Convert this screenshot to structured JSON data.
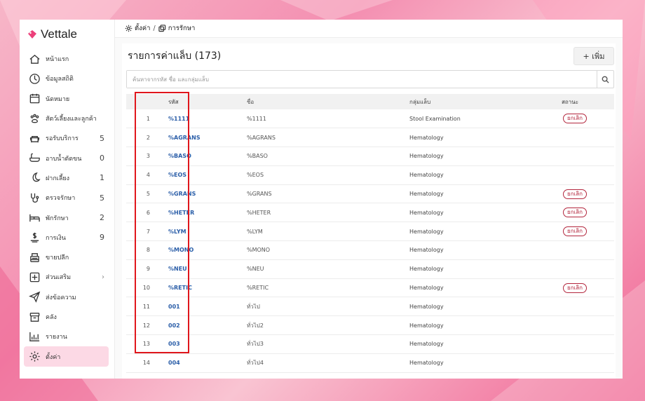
{
  "app": {
    "brand": "Vettale"
  },
  "colors": {
    "accent": "#ec407a",
    "active_bg": "#fcd9e5",
    "link": "#2b5ea8",
    "badge": "#b3263d",
    "highlight": "#e0161c"
  },
  "sidebar": {
    "items": [
      {
        "label": "หน้าแรก",
        "icon": "home-icon",
        "count": ""
      },
      {
        "label": "ข้อมูลสถิติ",
        "icon": "stats-icon",
        "count": ""
      },
      {
        "label": "นัดหมาย",
        "icon": "calendar-icon",
        "count": ""
      },
      {
        "label": "สัตว์เลี้ยงและลูกค้า",
        "icon": "paw-icon",
        "count": ""
      },
      {
        "label": "รอรับบริการ",
        "icon": "sofa-icon",
        "count": "5"
      },
      {
        "label": "อาบน้ำตัดขน",
        "icon": "bathtub-icon",
        "count": "0"
      },
      {
        "label": "ฝากเลี้ยง",
        "icon": "moon-icon",
        "count": "1"
      },
      {
        "label": "ตรวจรักษา",
        "icon": "stethoscope-icon",
        "count": "5"
      },
      {
        "label": "พักรักษา",
        "icon": "bed-icon",
        "count": "2"
      },
      {
        "label": "การเงิน",
        "icon": "money-icon",
        "count": "9"
      },
      {
        "label": "ขายปลีก",
        "icon": "register-icon",
        "count": ""
      },
      {
        "label": "ส่วนเสริม",
        "icon": "plus-box-icon",
        "count": "›"
      },
      {
        "label": "ส่งข้อความ",
        "icon": "send-icon",
        "count": ""
      },
      {
        "label": "คลัง",
        "icon": "archive-icon",
        "count": ""
      },
      {
        "label": "รายงาน",
        "icon": "chart-icon",
        "count": ""
      },
      {
        "label": "ตั้งค่า",
        "icon": "gear-icon",
        "count": ""
      }
    ]
  },
  "breadcrumb": {
    "root": "ตั้งค่า",
    "separator": "/",
    "current": "การรักษา"
  },
  "panel": {
    "title": "รายการค่าแล็บ",
    "count": "(173)",
    "add_label": "+ เพิ่ม"
  },
  "search": {
    "placeholder": "ค้นหาจากรหัส ชื่อ และกลุ่มแล็บ"
  },
  "table": {
    "headers": {
      "code": "รหัส",
      "name": "ชื่อ",
      "group": "กลุ่มแล็บ",
      "status": "สถานะ"
    },
    "rows": [
      {
        "idx": "1",
        "code": "%1111",
        "name": "%1111",
        "group": "Stool Examination",
        "status": "ยกเลิก"
      },
      {
        "idx": "2",
        "code": "%AGRANS",
        "name": "%AGRANS",
        "group": "Hematology",
        "status": ""
      },
      {
        "idx": "3",
        "code": "%BASO",
        "name": "%BASO",
        "group": "Hematology",
        "status": ""
      },
      {
        "idx": "4",
        "code": "%EOS",
        "name": "%EOS",
        "group": "Hematology",
        "status": ""
      },
      {
        "idx": "5",
        "code": "%GRANS",
        "name": "%GRANS",
        "group": "Hematology",
        "status": "ยกเลิก"
      },
      {
        "idx": "6",
        "code": "%HETER",
        "name": "%HETER",
        "group": "Hematology",
        "status": "ยกเลิก"
      },
      {
        "idx": "7",
        "code": "%LYM",
        "name": "%LYM",
        "group": "Hematology",
        "status": "ยกเลิก"
      },
      {
        "idx": "8",
        "code": "%MONO",
        "name": "%MONO",
        "group": "Hematology",
        "status": ""
      },
      {
        "idx": "9",
        "code": "%NEU",
        "name": "%NEU",
        "group": "Hematology",
        "status": ""
      },
      {
        "idx": "10",
        "code": "%RETIC",
        "name": "%RETIC",
        "group": "Hematology",
        "status": "ยกเลิก"
      },
      {
        "idx": "11",
        "code": "001",
        "name": "ทั่วไป",
        "group": "Hematology",
        "status": ""
      },
      {
        "idx": "12",
        "code": "002",
        "name": "ทั่วไป2",
        "group": "Hematology",
        "status": ""
      },
      {
        "idx": "13",
        "code": "003",
        "name": "ทั่วไป3",
        "group": "Hematology",
        "status": ""
      },
      {
        "idx": "14",
        "code": "004",
        "name": "ทั่วไป4",
        "group": "Hematology",
        "status": ""
      }
    ]
  }
}
